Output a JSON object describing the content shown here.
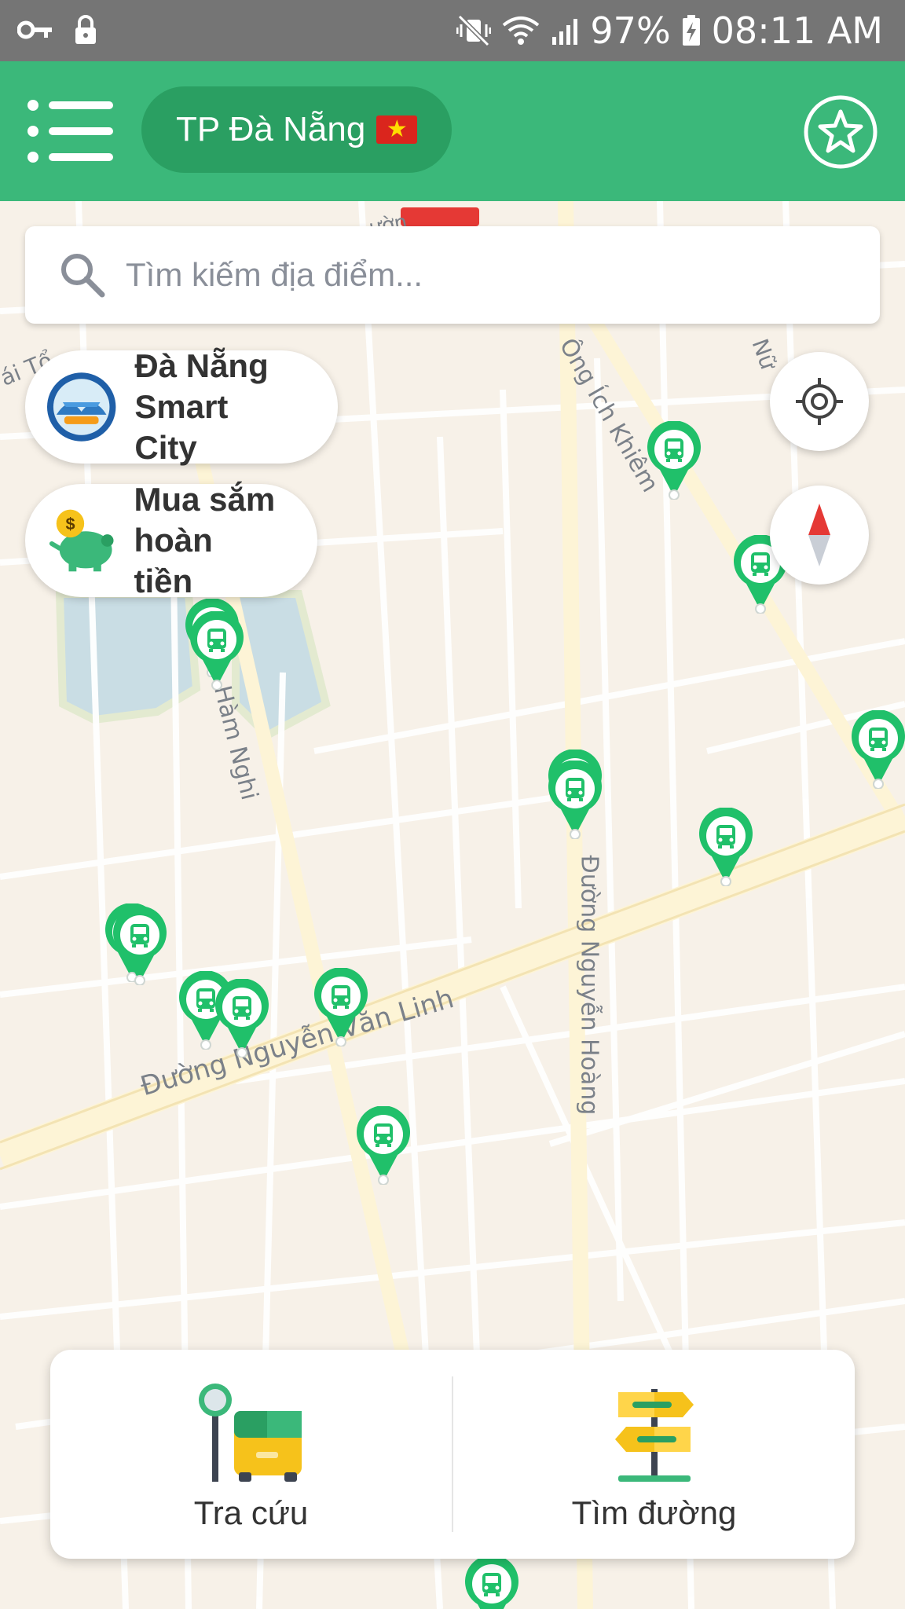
{
  "status_bar": {
    "battery": "97%",
    "time": "08:11 AM",
    "icons": [
      "key-icon",
      "lock-icon",
      "vibrate-mute-icon",
      "wifi-icon",
      "signal-icon",
      "battery-charging-icon"
    ]
  },
  "app_bar": {
    "city_label": "TP Đà Nẵng",
    "flag": "vietnam-flag-icon",
    "menu_icon": "hamburger-menu-icon",
    "favorite_icon": "star-icon",
    "colors": {
      "primary": "#3bb87a",
      "primary_dark": "#2a9f62"
    }
  },
  "search": {
    "placeholder": "Tìm kiếm địa điểm..."
  },
  "chips": [
    {
      "label_line1": "Đà Nẵng",
      "label_line2": "Smart City",
      "icon": "danang-logo-icon"
    },
    {
      "label_line1": "Mua sắm",
      "label_line2": "hoàn tiền",
      "icon": "piggy-bank-icon"
    }
  ],
  "map": {
    "streets": [
      "Đường Nguyễn Văn Linh",
      "Đường Nguyễn Hoàng",
      "Ông Ích Khiêm",
      "Hàm Nghi",
      "ái Tổ",
      "Nữ",
      "ườn"
    ],
    "controls": [
      "my-location-icon",
      "compass-icon"
    ]
  },
  "bottom_panel": {
    "items": [
      {
        "label": "Tra cứu",
        "icon": "bus-stop-icon"
      },
      {
        "label": "Tìm đường",
        "icon": "signpost-icon"
      }
    ]
  }
}
